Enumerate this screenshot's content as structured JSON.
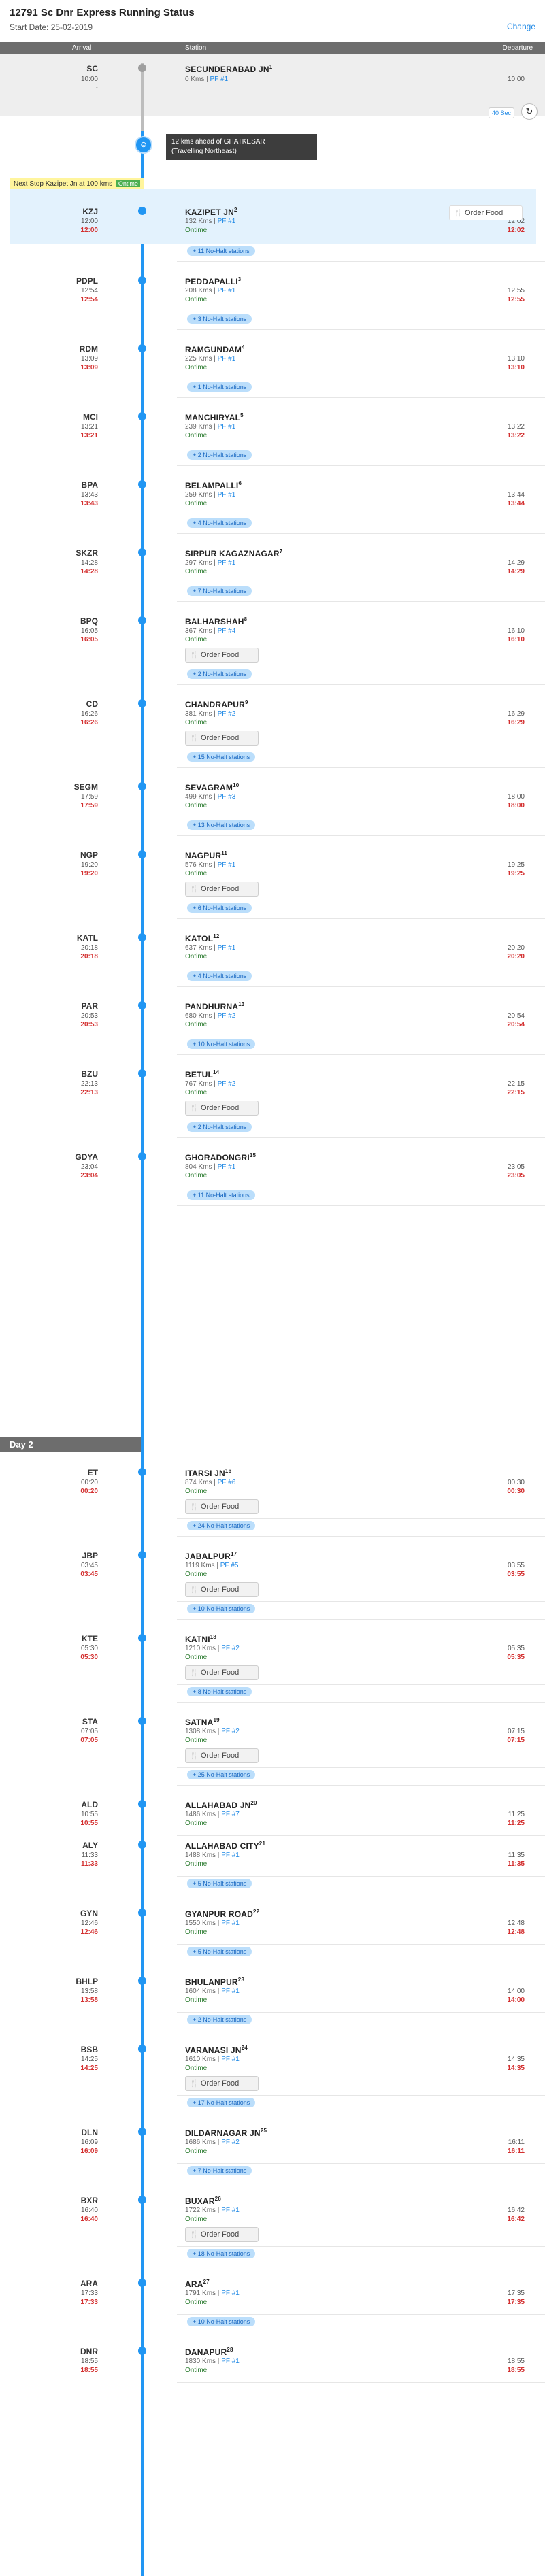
{
  "header": {
    "title": "12791 Sc Dnr Express Running Status",
    "start_date": "Start Date: 25-02-2019",
    "change": "Change"
  },
  "columns": {
    "arrival": "Arrival",
    "station": "Station",
    "departure": "Departure"
  },
  "origin": {
    "code": "SC",
    "arr": "10:00",
    "arr_dash": "-",
    "name": "SECUNDERABAD JN",
    "num": "1",
    "km": "0 Kms",
    "pf": "PF #1",
    "dep": "10:00"
  },
  "ahead": {
    "line1": "12 kms ahead of GHATKESAR",
    "line2": "(Travelling Northeast)"
  },
  "controls": {
    "sec": "40 Sec",
    "refresh": "↻"
  },
  "next_stop": {
    "text": "Next Stop Kazipet Jn at 100 kms",
    "badge": "Ontime"
  },
  "order_food_label": "Order Food",
  "day2": "Day 2",
  "stations": [
    {
      "code": "KZJ",
      "sa": "12:00",
      "aa": "12:00",
      "name": "KAZIPET JN",
      "num": "2",
      "km": "132 Kms",
      "pf": "PF #1",
      "status": "Ontime",
      "sd": "12:02",
      "ad": "12:02",
      "food": true
    },
    {
      "nohalt": "+ 11 No-Halt stations"
    },
    {
      "code": "PDPL",
      "sa": "12:54",
      "aa": "12:54",
      "name": "PEDDAPALLI",
      "num": "3",
      "km": "208 Kms",
      "pf": "PF #1",
      "status": "Ontime",
      "sd": "12:55",
      "ad": "12:55",
      "food": false
    },
    {
      "nohalt": "+ 3 No-Halt stations"
    },
    {
      "code": "RDM",
      "sa": "13:09",
      "aa": "13:09",
      "name": "RAMGUNDAM",
      "num": "4",
      "km": "225 Kms",
      "pf": "PF #1",
      "status": "Ontime",
      "sd": "13:10",
      "ad": "13:10",
      "food": false
    },
    {
      "nohalt": "+ 1 No-Halt stations"
    },
    {
      "code": "MCI",
      "sa": "13:21",
      "aa": "13:21",
      "name": "MANCHIRYAL",
      "num": "5",
      "km": "239 Kms",
      "pf": "PF #1",
      "status": "Ontime",
      "sd": "13:22",
      "ad": "13:22",
      "food": false
    },
    {
      "nohalt": "+ 2 No-Halt stations"
    },
    {
      "code": "BPA",
      "sa": "13:43",
      "aa": "13:43",
      "name": "BELAMPALLI",
      "num": "6",
      "km": "259 Kms",
      "pf": "PF #1",
      "status": "Ontime",
      "sd": "13:44",
      "ad": "13:44",
      "food": false
    },
    {
      "nohalt": "+ 4 No-Halt stations"
    },
    {
      "code": "SKZR",
      "sa": "14:28",
      "aa": "14:28",
      "name": "SIRPUR KAGAZNAGAR",
      "num": "7",
      "km": "297 Kms",
      "pf": "PF #1",
      "status": "Ontime",
      "sd": "14:29",
      "ad": "14:29",
      "food": false
    },
    {
      "nohalt": "+ 7 No-Halt stations"
    },
    {
      "code": "BPQ",
      "sa": "16:05",
      "aa": "16:05",
      "name": "BALHARSHAH",
      "num": "8",
      "km": "367 Kms",
      "pf": "PF #4",
      "status": "Ontime",
      "sd": "16:10",
      "ad": "16:10",
      "food": true
    },
    {
      "nohalt": "+ 2 No-Halt stations"
    },
    {
      "code": "CD",
      "sa": "16:26",
      "aa": "16:26",
      "name": "CHANDRAPUR",
      "num": "9",
      "km": "381 Kms",
      "pf": "PF #2",
      "status": "Ontime",
      "sd": "16:29",
      "ad": "16:29",
      "food": true
    },
    {
      "nohalt": "+ 15 No-Halt stations"
    },
    {
      "code": "SEGM",
      "sa": "17:59",
      "aa": "17:59",
      "name": "SEVAGRAM",
      "num": "10",
      "km": "499 Kms",
      "pf": "PF #3",
      "status": "Ontime",
      "sd": "18:00",
      "ad": "18:00",
      "food": false
    },
    {
      "nohalt": "+ 13 No-Halt stations"
    },
    {
      "code": "NGP",
      "sa": "19:20",
      "aa": "19:20",
      "name": "NAGPUR",
      "num": "11",
      "km": "576 Kms",
      "pf": "PF #1",
      "status": "Ontime",
      "sd": "19:25",
      "ad": "19:25",
      "food": true
    },
    {
      "nohalt": "+ 6 No-Halt stations"
    },
    {
      "code": "KATL",
      "sa": "20:18",
      "aa": "20:18",
      "name": "KATOL",
      "num": "12",
      "km": "637 Kms",
      "pf": "PF #1",
      "status": "Ontime",
      "sd": "20:20",
      "ad": "20:20",
      "food": false
    },
    {
      "nohalt": "+ 4 No-Halt stations"
    },
    {
      "code": "PAR",
      "sa": "20:53",
      "aa": "20:53",
      "name": "PANDHURNA",
      "num": "13",
      "km": "680 Kms",
      "pf": "PF #2",
      "status": "Ontime",
      "sd": "20:54",
      "ad": "20:54",
      "food": false
    },
    {
      "nohalt": "+ 10 No-Halt stations"
    },
    {
      "code": "BZU",
      "sa": "22:13",
      "aa": "22:13",
      "name": "BETUL",
      "num": "14",
      "km": "767 Kms",
      "pf": "PF #2",
      "status": "Ontime",
      "sd": "22:15",
      "ad": "22:15",
      "food": true
    },
    {
      "nohalt": "+ 2 No-Halt stations"
    },
    {
      "code": "GDYA",
      "sa": "23:04",
      "aa": "23:04",
      "name": "GHORADONGRI",
      "num": "15",
      "km": "804 Kms",
      "pf": "PF #1",
      "status": "Ontime",
      "sd": "23:05",
      "ad": "23:05",
      "food": false
    },
    {
      "nohalt": "+ 11 No-Halt stations"
    },
    {
      "code": "ET",
      "sa": "00:20",
      "aa": "00:20",
      "name": "ITARSI JN",
      "num": "16",
      "km": "874 Kms",
      "pf": "PF #6",
      "status": "Ontime",
      "sd": "00:30",
      "ad": "00:30",
      "food": true
    },
    {
      "nohalt": "+ 24 No-Halt stations"
    },
    {
      "code": "JBP",
      "sa": "03:45",
      "aa": "03:45",
      "name": "JABALPUR",
      "num": "17",
      "km": "1119 Kms",
      "pf": "PF #5",
      "status": "Ontime",
      "sd": "03:55",
      "ad": "03:55",
      "food": true
    },
    {
      "nohalt": "+ 10 No-Halt stations"
    },
    {
      "code": "KTE",
      "sa": "05:30",
      "aa": "05:30",
      "name": "KATNI",
      "num": "18",
      "km": "1210 Kms",
      "pf": "PF #2",
      "status": "Ontime",
      "sd": "05:35",
      "ad": "05:35",
      "food": true
    },
    {
      "nohalt": "+ 8 No-Halt stations"
    },
    {
      "code": "STA",
      "sa": "07:05",
      "aa": "07:05",
      "name": "SATNA",
      "num": "19",
      "km": "1308 Kms",
      "pf": "PF #2",
      "status": "Ontime",
      "sd": "07:15",
      "ad": "07:15",
      "food": true
    },
    {
      "nohalt": "+ 25 No-Halt stations"
    },
    {
      "code": "ALD",
      "sa": "10:55",
      "aa": "10:55",
      "name": "ALLAHABAD JN",
      "num": "20",
      "km": "1486 Kms",
      "pf": "PF #7",
      "status": "Ontime",
      "sd": "11:25",
      "ad": "11:25",
      "food": false
    },
    {
      "code": "ALY",
      "sa": "11:33",
      "aa": "11:33",
      "name": "ALLAHABAD CITY",
      "num": "21",
      "km": "1488 Kms",
      "pf": "PF #1",
      "status": "Ontime",
      "sd": "11:35",
      "ad": "11:35",
      "food": false
    },
    {
      "nohalt": "+ 5 No-Halt stations"
    },
    {
      "code": "GYN",
      "sa": "12:46",
      "aa": "12:46",
      "name": "GYANPUR ROAD",
      "num": "22",
      "km": "1550 Kms",
      "pf": "PF #1",
      "status": "Ontime",
      "sd": "12:48",
      "ad": "12:48",
      "food": false
    },
    {
      "nohalt": "+ 5 No-Halt stations"
    },
    {
      "code": "BHLP",
      "sa": "13:58",
      "aa": "13:58",
      "name": "BHULANPUR",
      "num": "23",
      "km": "1604 Kms",
      "pf": "PF #1",
      "status": "Ontime",
      "sd": "14:00",
      "ad": "14:00",
      "food": false
    },
    {
      "nohalt": "+ 2 No-Halt stations"
    },
    {
      "code": "BSB",
      "sa": "14:25",
      "aa": "14:25",
      "name": "VARANASI JN",
      "num": "24",
      "km": "1610 Kms",
      "pf": "PF #1",
      "status": "Ontime",
      "sd": "14:35",
      "ad": "14:35",
      "food": true
    },
    {
      "nohalt": "+ 17 No-Halt stations"
    },
    {
      "code": "DLN",
      "sa": "16:09",
      "aa": "16:09",
      "name": "DILDARNAGAR JN",
      "num": "25",
      "km": "1686 Kms",
      "pf": "PF #2",
      "status": "Ontime",
      "sd": "16:11",
      "ad": "16:11",
      "food": false
    },
    {
      "nohalt": "+ 7 No-Halt stations"
    },
    {
      "code": "BXR",
      "sa": "16:40",
      "aa": "16:40",
      "name": "BUXAR",
      "num": "26",
      "km": "1722 Kms",
      "pf": "PF #1",
      "status": "Ontime",
      "sd": "16:42",
      "ad": "16:42",
      "food": true
    },
    {
      "nohalt": "+ 18 No-Halt stations"
    },
    {
      "code": "ARA",
      "sa": "17:33",
      "aa": "17:33",
      "name": "ARA",
      "num": "27",
      "km": "1791 Kms",
      "pf": "PF #1",
      "status": "Ontime",
      "sd": "17:35",
      "ad": "17:35",
      "food": false
    },
    {
      "nohalt": "+ 10 No-Halt stations"
    },
    {
      "code": "DNR",
      "sa": "18:55",
      "aa": "18:55",
      "name": "DANAPUR",
      "num": "28",
      "km": "1830 Kms",
      "pf": "PF #1",
      "status": "Ontime",
      "sd": "18:55",
      "ad": "18:55",
      "food": false
    }
  ]
}
